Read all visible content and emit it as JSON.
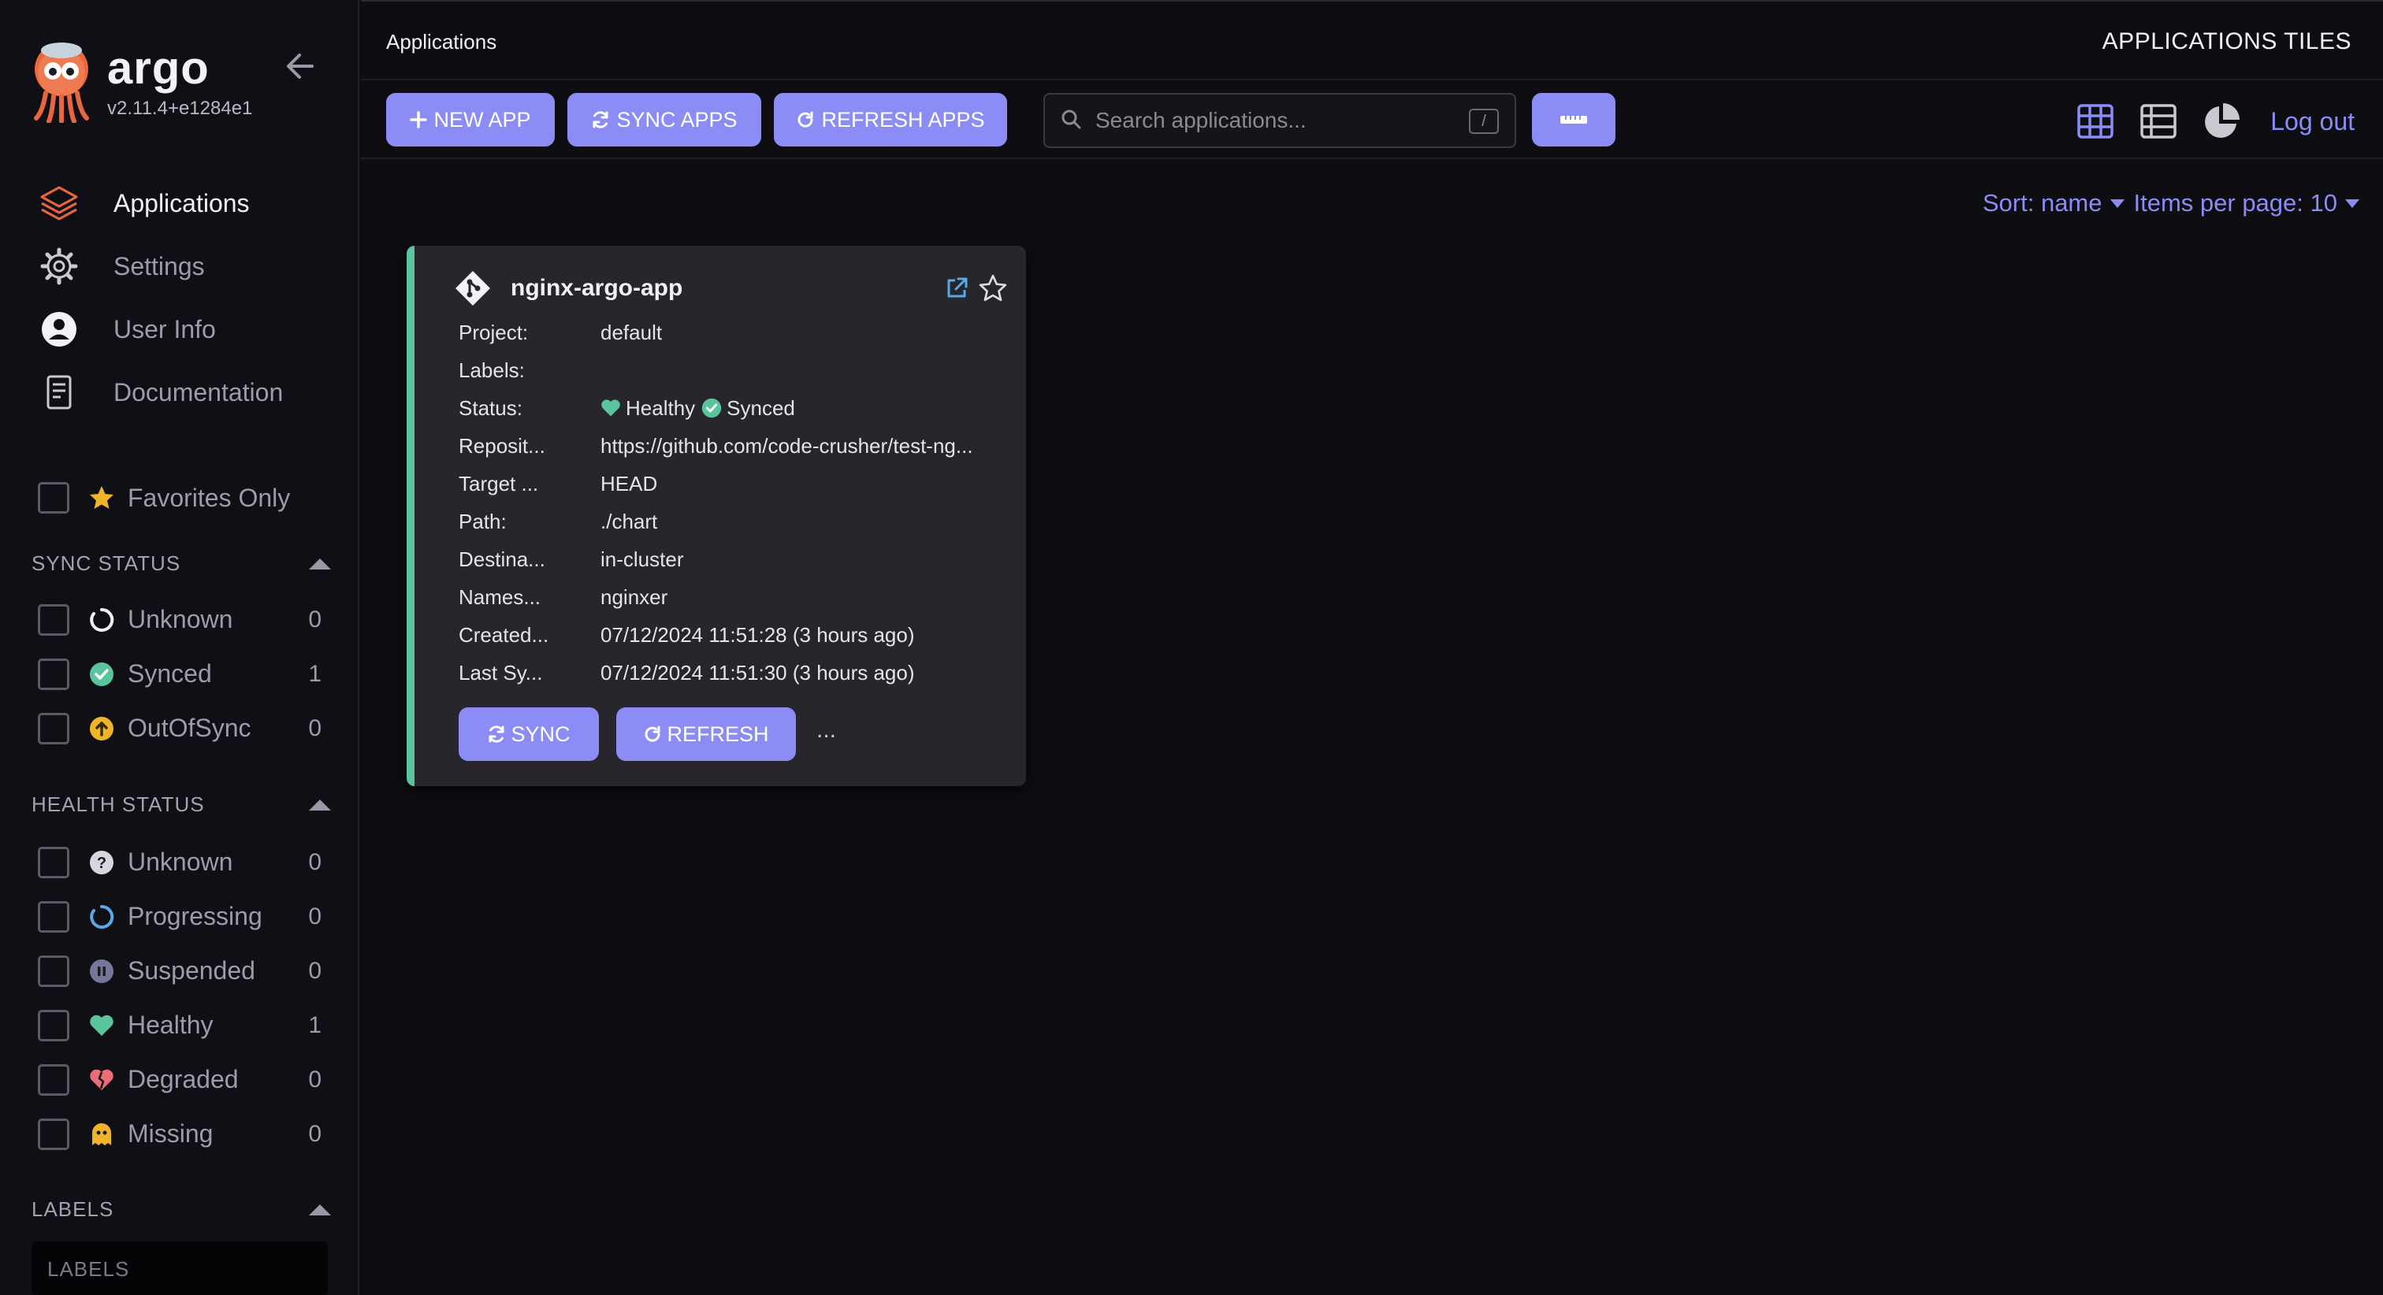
{
  "brand": {
    "name": "argo",
    "version": "v2.11.4+e1284e1"
  },
  "nav": [
    {
      "label": "Applications",
      "icon": "layers-icon"
    },
    {
      "label": "Settings",
      "icon": "gear-icon"
    },
    {
      "label": "User Info",
      "icon": "user-icon"
    },
    {
      "label": "Documentation",
      "icon": "book-icon"
    }
  ],
  "favorites": {
    "label": "Favorites Only"
  },
  "sync_status": {
    "title": "SYNC STATUS",
    "items": [
      {
        "label": "Unknown",
        "count": "0",
        "icon": "circle-notch-icon"
      },
      {
        "label": "Synced",
        "count": "1",
        "icon": "check-circle-icon"
      },
      {
        "label": "OutOfSync",
        "count": "0",
        "icon": "arrow-up-circle-icon"
      }
    ]
  },
  "health_status": {
    "title": "HEALTH STATUS",
    "items": [
      {
        "label": "Unknown",
        "count": "0",
        "icon": "question-circle-icon"
      },
      {
        "label": "Progressing",
        "count": "0",
        "icon": "progress-circle-icon"
      },
      {
        "label": "Suspended",
        "count": "0",
        "icon": "pause-circle-icon"
      },
      {
        "label": "Healthy",
        "count": "1",
        "icon": "heart-icon"
      },
      {
        "label": "Degraded",
        "count": "0",
        "icon": "broken-heart-icon"
      },
      {
        "label": "Missing",
        "count": "0",
        "icon": "ghost-icon"
      }
    ]
  },
  "labels_section": {
    "title": "LABELS",
    "placeholder": "LABELS"
  },
  "topbar": {
    "breadcrumb": "Applications",
    "page_kind": "APPLICATIONS TILES"
  },
  "toolbar": {
    "new_app": "NEW APP",
    "sync_apps": "SYNC APPS",
    "refresh_apps": "REFRESH APPS",
    "search_placeholder": "Search applications...",
    "shortcut": "/",
    "logout": "Log out"
  },
  "sort": {
    "sort_label": "Sort: name",
    "per_page_label": "Items per page: 10"
  },
  "card": {
    "name": "nginx-argo-app",
    "rows": [
      {
        "key": "Project:",
        "value": "default"
      },
      {
        "key": "Labels:",
        "value": ""
      },
      {
        "key": "Status:",
        "value": ""
      },
      {
        "key": "Reposit...",
        "value": "https://github.com/code-crusher/test-ng..."
      },
      {
        "key": "Target ...",
        "value": "HEAD"
      },
      {
        "key": "Path:",
        "value": "./chart"
      },
      {
        "key": "Destina...",
        "value": "in-cluster"
      },
      {
        "key": "Names...",
        "value": "nginxer"
      },
      {
        "key": "Created...",
        "value": "07/12/2024 11:51:28  (3 hours ago)"
      },
      {
        "key": "Last Sy...",
        "value": "07/12/2024 11:51:30  (3 hours ago)"
      }
    ],
    "health": "Healthy",
    "sync": "Synced",
    "sync_btn": "SYNC",
    "refresh_btn": "REFRESH",
    "more": "..."
  },
  "colors": {
    "accent": "#8b8cf6",
    "healthy": "#5ac49d",
    "warning": "#f0b429",
    "degraded": "#e96d76"
  }
}
